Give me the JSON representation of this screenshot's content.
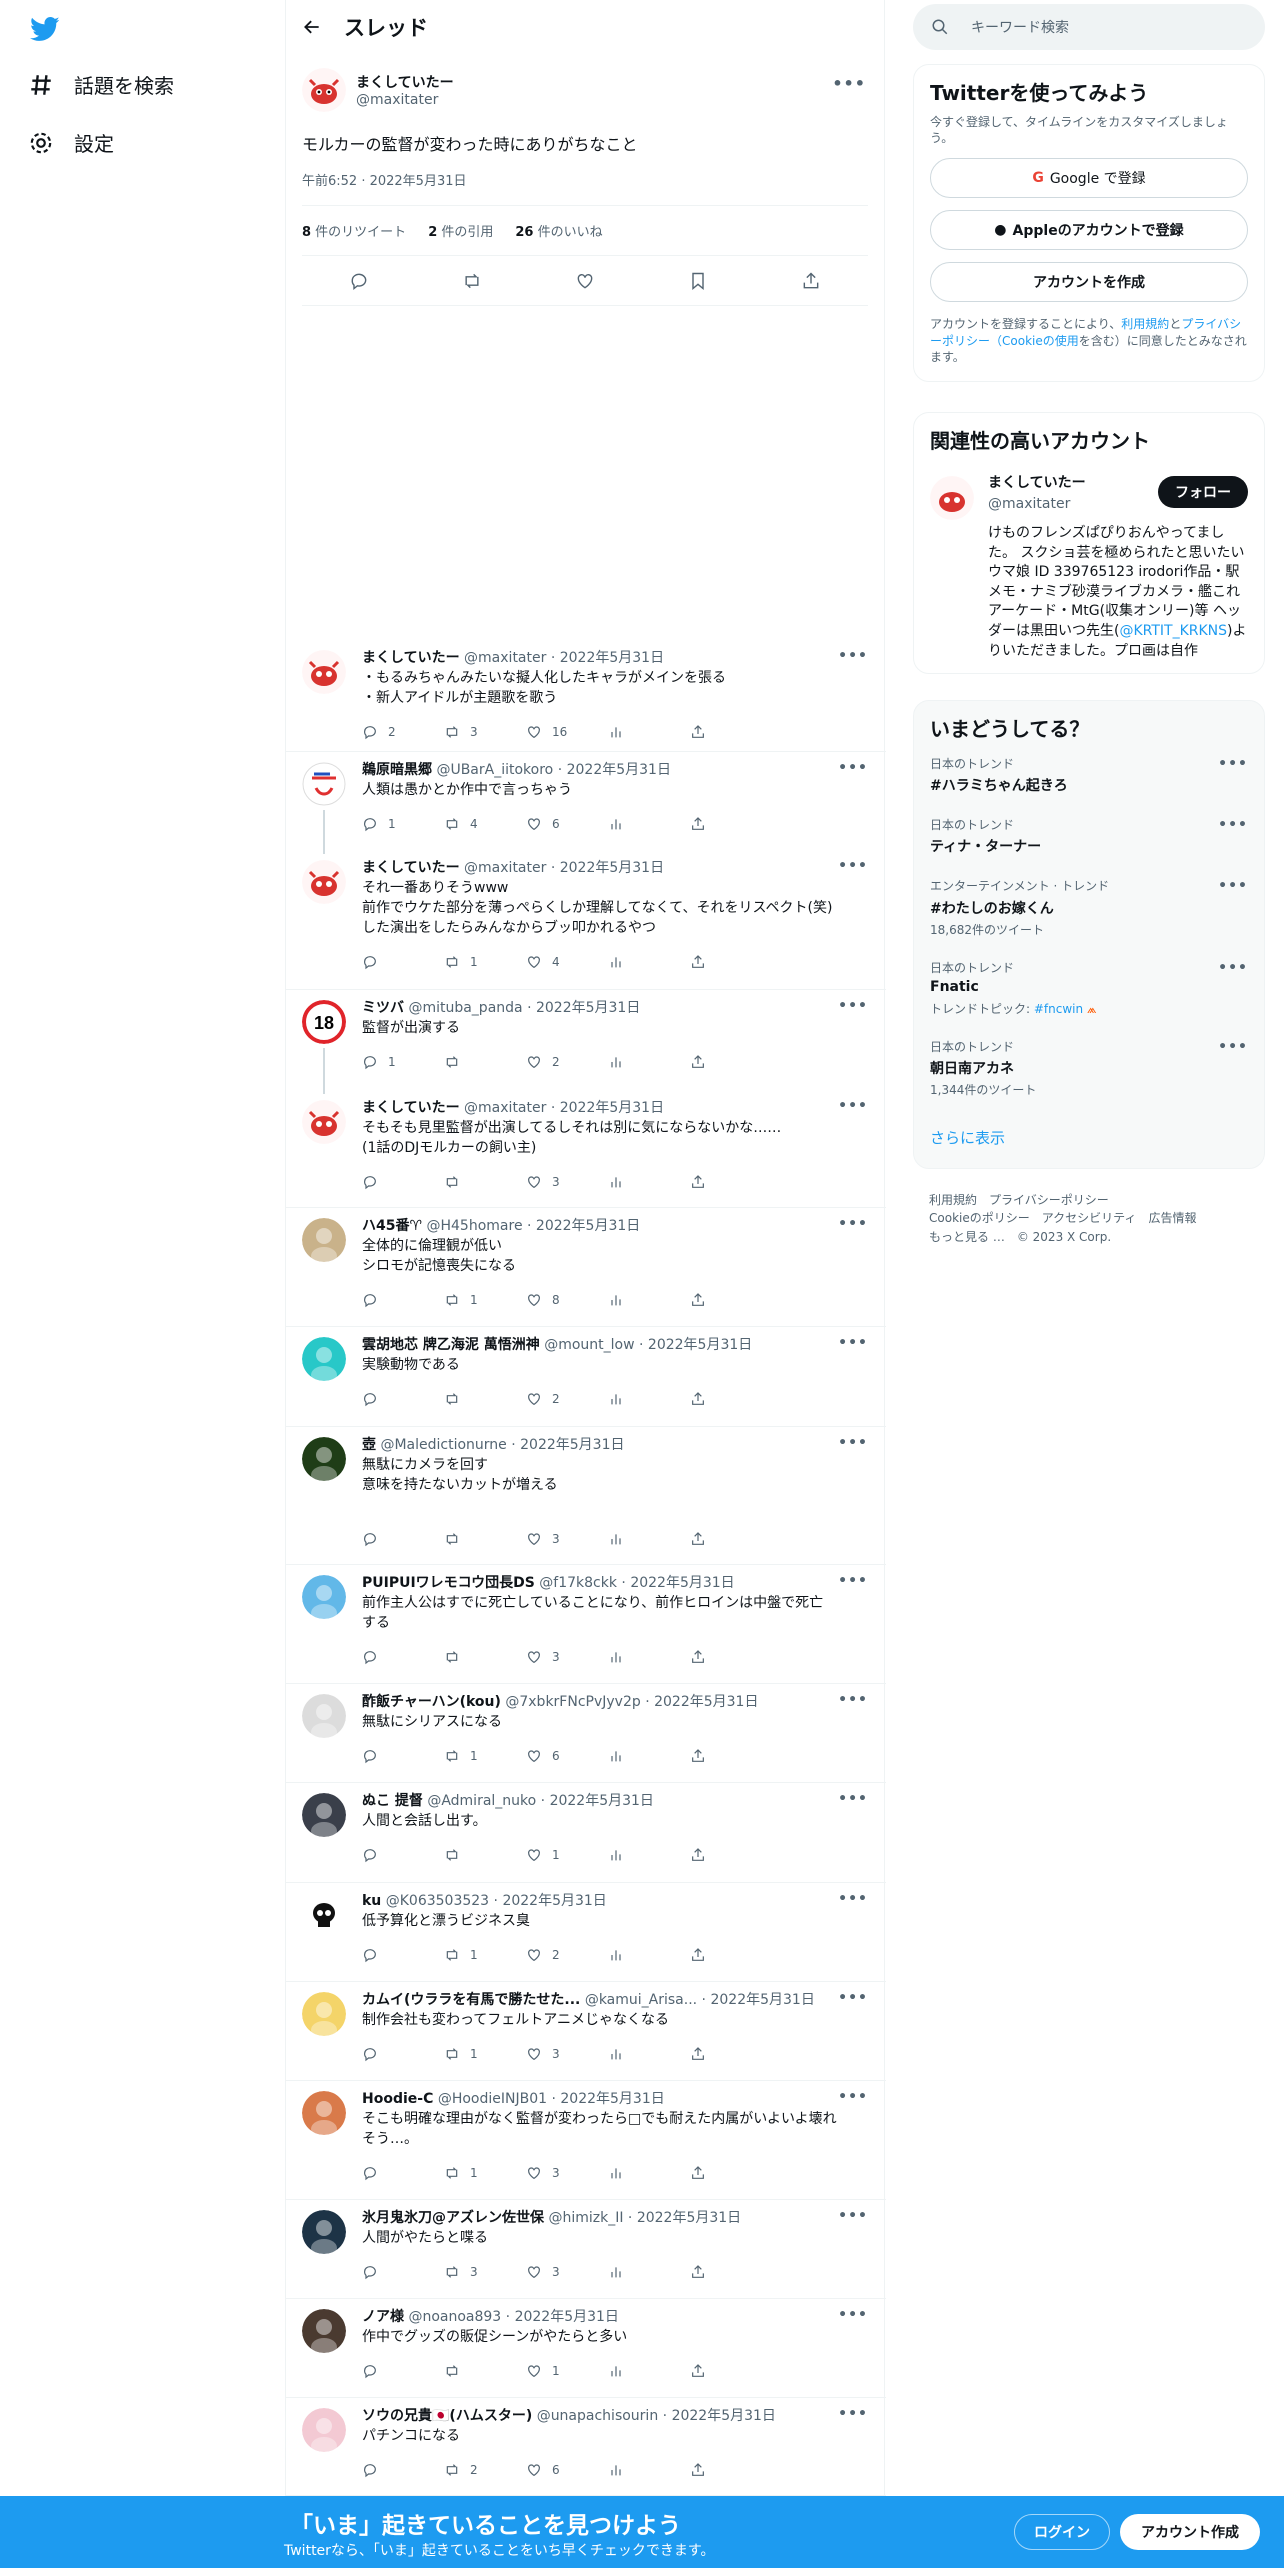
{
  "nav": {
    "explore": "話題を検索",
    "settings": "設定"
  },
  "thread": {
    "title": "スレッド",
    "main": {
      "name": "まくしていたー",
      "handle": "@maxitater",
      "text": "モルカーの監督が変わった時にありがちなこと",
      "time": "午前6:52 · 2022年5月31日",
      "retweets_count": "8",
      "retweets_label": " 件のリツイート",
      "quotes_count": "2",
      "quotes_label": " 件の引用",
      "likes_count": "26",
      "likes_label": " 件のいいね"
    },
    "replies": [
      {
        "name": "まくしていたー",
        "handle": "@maxitater",
        "date": "2022年5月31日",
        "lines": [
          "・もるみちゃんみたいな擬人化したキャラがメインを張る",
          "・新人アイドルが主題歌を歌う"
        ],
        "reply": "2",
        "rt": "3",
        "like": "16",
        "avatar": "crab"
      },
      {
        "name": "鵜原暗黒郷",
        "handle": "@UBarA_iitokoro",
        "date": "2022年5月31日",
        "lines": [
          "人類は愚かとか作中で言っちゃう"
        ],
        "reply": "1",
        "rt": "4",
        "like": "6",
        "avatar": "logo"
      },
      {
        "name": "まくしていたー",
        "handle": "@maxitater",
        "date": "2022年5月31日",
        "lines": [
          "それ一番ありそうwww",
          "前作でウケた部分を薄っぺらくしか理解してなくて、それをリスペクト(笑)",
          "した演出をしたらみんなからブッ叩かれるやつ"
        ],
        "reply": "",
        "rt": "1",
        "like": "4",
        "avatar": "crab"
      },
      {
        "name": "ミツバ",
        "handle": "@mituba_panda",
        "date": "2022年5月31日",
        "lines": [
          "監督が出演する"
        ],
        "reply": "1",
        "rt": "",
        "like": "2",
        "avatar": "r18"
      },
      {
        "name": "まくしていたー",
        "handle": "@maxitater",
        "date": "2022年5月31日",
        "lines": [
          "そもそも見里監督が出演してるしそれは別に気にならないかな……",
          "(1話のDJモルカーの飼い主)"
        ],
        "reply": "",
        "rt": "",
        "like": "3",
        "avatar": "crab"
      },
      {
        "name": "ハ45番♈",
        "handle": "@H45homare",
        "date": "2022年5月31日",
        "lines": [
          "全体的に倫理観が低い",
          "シロモが記憶喪失になる"
        ],
        "reply": "",
        "rt": "1",
        "like": "8",
        "avatar": "anime1"
      },
      {
        "name": "雲胡地芯 牌乙海泥 萬悟洲神",
        "handle": "@mount_low",
        "date": "2022年5月31日",
        "lines": [
          "実験動物である"
        ],
        "reply": "",
        "rt": "",
        "like": "2",
        "avatar": "cyan"
      },
      {
        "name": "壺",
        "handle": "@Maledictionurne",
        "date": "2022年5月31日",
        "lines": [
          "無駄にカメラを回す",
          "",
          "意味を持たないカットが増える"
        ],
        "reply": "",
        "rt": "",
        "like": "3",
        "avatar": "pot"
      },
      {
        "name": "PUIPUIワレモコウ団長DS",
        "handle": "@f17k8ckk",
        "date": "2022年5月31日",
        "lines": [
          "前作主人公はすでに死亡していることになり、前作ヒロインは中盤で死亡",
          "する"
        ],
        "reply": "",
        "rt": "",
        "like": "3",
        "avatar": "blue"
      },
      {
        "name": "酢飯チャーハン(kou)",
        "handle": "@7xbkrFNcPvJyv2p",
        "date": "2022年5月31日",
        "lines": [
          "無駄にシリアスになる"
        ],
        "reply": "",
        "rt": "1",
        "like": "6",
        "avatar": "sketch"
      },
      {
        "name": "ぬこ 提督",
        "handle": "@Admiral_nuko",
        "date": "2022年5月31日",
        "lines": [
          "人間と会話し出す。"
        ],
        "reply": "",
        "rt": "",
        "like": "1",
        "avatar": "dark"
      },
      {
        "name": "ku",
        "handle": "@K063503523",
        "date": "2022年5月31日",
        "lines": [
          "低予算化と漂うビジネス臭"
        ],
        "reply": "",
        "rt": "1",
        "like": "2",
        "avatar": "skull"
      },
      {
        "name": "カムイ(ウララを有馬で勝たせた...",
        "handle": "@kamui_Arisa...",
        "date": "2022年5月31日",
        "lines": [
          "制作会社も変わってフェルトアニメじゃなくなる"
        ],
        "reply": "",
        "rt": "1",
        "like": "3",
        "avatar": "yellow"
      },
      {
        "name": "Hoodie-C",
        "handle": "@HoodieINJB01",
        "date": "2022年5月31日",
        "lines": [
          "そこも明確な理由がなく監督が変わったら□でも耐えた内属がいよいよ壊れ",
          "そう…。"
        ],
        "reply": "",
        "rt": "1",
        "like": "3",
        "avatar": "orange"
      },
      {
        "name": "氷月鬼氷刀@アズレン佐世保",
        "handle": "@himizk_II",
        "date": "2022年5月31日",
        "lines": [
          "人間がやたらと喋る"
        ],
        "reply": "",
        "rt": "3",
        "like": "3",
        "avatar": "navy"
      },
      {
        "name": "ノア様",
        "handle": "@noanoa893",
        "date": "2022年5月31日",
        "lines": [
          "作中でグッズの販促シーンがやたらと多い"
        ],
        "reply": "",
        "rt": "",
        "like": "1",
        "avatar": "face"
      },
      {
        "name": "ソウの兄貴🇯🇵(ハムスター)",
        "handle": "@unapachisourin",
        "date": "2022年5月31日",
        "lines": [
          "パチンコになる"
        ],
        "reply": "",
        "rt": "2",
        "like": "6",
        "avatar": "pink"
      }
    ]
  },
  "search": {
    "placeholder": "キーワード検索"
  },
  "signup": {
    "title": "Twitterを使ってみよう",
    "subtitle": "今すぐ登録して、タイムラインをカスタマイズしましょう。",
    "google": "Google で登録",
    "apple": "Appleのアカウントで登録",
    "create": "アカウントを作成",
    "legal_1": "アカウントを登録することにより、",
    "legal_link1": "利用規約",
    "legal_2": "と",
    "legal_link2": "プライバシーポリシー（Cookieの使用",
    "legal_3": "を含む）に同意したとみなされます。"
  },
  "related": {
    "title": "関連性の高いアカウント",
    "name": "まくしていたー",
    "handle": "@maxitater",
    "follow": "フォロー",
    "bio_1": "けものフレンズぱぴりおんやってました。 スクショ芸を極められたと思いたい ウマ娘 ID 339765123 irodori作品・駅メモ・ナミブ砂漠ライブカメラ・艦これアーケード・MtG(収集オンリー)等 ヘッダーは黒田いつ先生(",
    "bio_link": "@KRTIT_KRKNS",
    "bio_2": ")よりいただきました。プロ画は自作"
  },
  "trends": {
    "title": "いまどうしてる？",
    "items": [
      {
        "meta": "日本のトレンド",
        "name": "#ハラミちゃん起きろ",
        "count": ""
      },
      {
        "meta": "日本のトレンド",
        "name": "ティナ・ターナー",
        "count": ""
      },
      {
        "meta": "エンターテインメント · トレンド",
        "name": "#わたしのお嫁くん",
        "count": "18,682件のツイート"
      },
      {
        "meta": "日本のトレンド",
        "name": "Fnatic",
        "count": "",
        "topic_label": "トレンドトピック: ",
        "topic": "#fncwin"
      },
      {
        "meta": "日本のトレンド",
        "name": "朝日南アカネ",
        "count": "1,344件のツイート"
      }
    ],
    "show_more": "さらに表示"
  },
  "footer": {
    "terms": "利用規約",
    "privacy": "プライバシーポリシー",
    "cookie": "Cookieのポリシー",
    "access": "アクセシビリティ",
    "ads": "広告情報",
    "more": "もっと見る …",
    "copy": "© 2023 X Corp."
  },
  "bottom": {
    "title": "「いま」起きていることを見つけよう",
    "subtitle": "Twitterなら、「いま」起きていることをいち早くチェックできます。",
    "login": "ログイン",
    "signup": "アカウント作成"
  },
  "colors": {
    "accent": "#1d9bf0",
    "text": "#0f1419",
    "muted": "#536471"
  }
}
